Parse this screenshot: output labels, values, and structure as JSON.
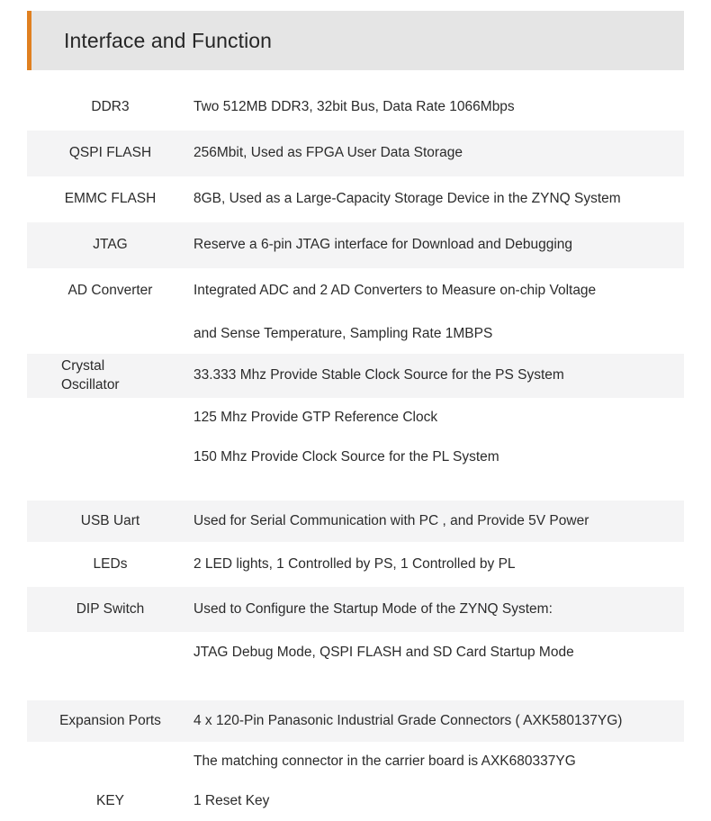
{
  "header": {
    "title": "Interface and Function",
    "accent_color": "#e08020",
    "band_color": "#e5e5e5"
  },
  "table": {
    "shaded_row_color": "#f4f4f5",
    "rows": [
      {
        "label": "DDR3",
        "value": "Two 512MB DDR3, 32bit Bus, Data Rate 1066Mbps",
        "shaded": false
      },
      {
        "label": "QSPI FLASH",
        "value": "256Mbit, Used as FPGA User Data Storage",
        "shaded": true
      },
      {
        "label": "EMMC FLASH",
        "value": "8GB, Used as a Large-Capacity Storage Device in the ZYNQ System",
        "shaded": false
      },
      {
        "label": "JTAG",
        "value": "Reserve a 6-pin JTAG interface for  Download and Debugging",
        "shaded": true
      },
      {
        "label": "AD Converter",
        "value": "Integrated ADC and 2 AD Converters to Measure on-chip Voltage",
        "shaded": false
      },
      {
        "label": "",
        "value": "and Sense Temperature, Sampling Rate 1MBPS",
        "shaded": false
      },
      {
        "label": "Crystal\nOscillator",
        "value": "33.333 Mhz  Provide Stable Clock Source for the PS System",
        "shaded": true
      },
      {
        "label": "",
        "value": "125 Mhz Provide GTP Reference Clock",
        "shaded": false
      },
      {
        "label": "",
        "value": "150 Mhz Provide Clock Source for the PL System",
        "shaded": false
      },
      {
        "label": "USB Uart",
        "value": "Used for Serial Communication with PC , and Provide 5V Power",
        "shaded": true
      },
      {
        "label": "LEDs",
        "value": "2 LED lights, 1 Controlled by PS, 1 Controlled by PL",
        "shaded": false
      },
      {
        "label": "DIP Switch",
        "value": "Used to Configure the Startup Mode of the ZYNQ System:",
        "shaded": true
      },
      {
        "label": "",
        "value": "JTAG Debug Mode, QSPI FLASH and SD Card Startup Mode",
        "shaded": false
      },
      {
        "label": "Expansion Ports",
        "value": "4 x 120-Pin Panasonic Industrial Grade Connectors ( AXK580137YG)",
        "shaded": true
      },
      {
        "label": "",
        "value": "The matching connector in the carrier board is  AXK680337YG",
        "shaded": false
      },
      {
        "label": "KEY",
        "value": "1 Reset Key",
        "shaded": false
      }
    ]
  }
}
